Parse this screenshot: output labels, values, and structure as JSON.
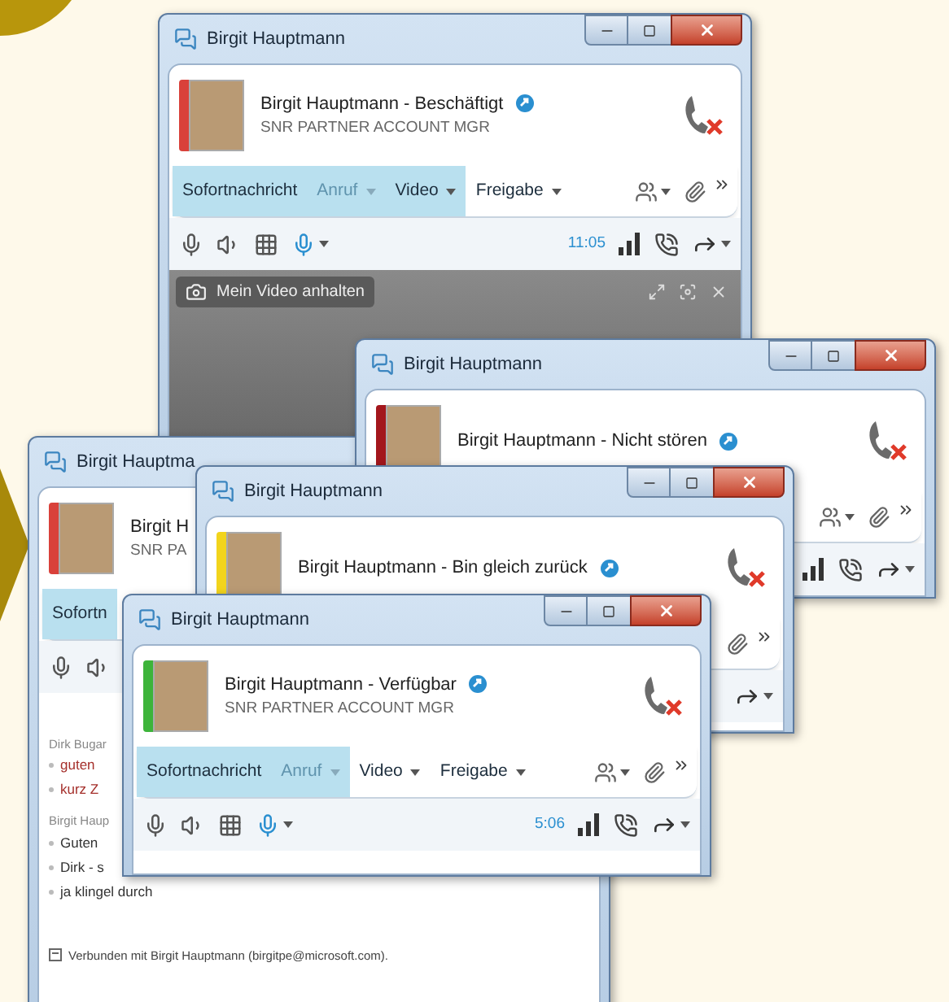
{
  "windows": [
    {
      "title": "Birgit Hauptmann",
      "color": "#d9413a",
      "name": "Birgit Hauptmann - Beschäftigt",
      "subtitle": "SNR PARTNER ACCOUNT MGR",
      "toolbar": [
        {
          "label": "Sofortnachricht",
          "disabled": false,
          "menu": false,
          "highlighted": true
        },
        {
          "label": "Anruf",
          "disabled": true,
          "menu": true,
          "highlighted": true
        },
        {
          "label": "Video",
          "disabled": false,
          "menu": true,
          "highlighted": true
        },
        {
          "label": "Freigabe",
          "disabled": false,
          "menu": true,
          "highlighted": false
        }
      ],
      "call_time": "11:05",
      "video_bar": {
        "label": "Mein Video anhalten"
      }
    },
    {
      "title": "Birgit Hauptma",
      "color": "#d9413a",
      "name": "Birgit H",
      "subtitle": "SNR PA",
      "toolbar": [
        {
          "label": "Sofortn",
          "disabled": false,
          "menu": false,
          "highlighted": true
        }
      ],
      "chat": {
        "groups": [
          {
            "sender": "Dirk Bugar",
            "kind": "remote",
            "messages": [
              "guten",
              "kurz Z"
            ]
          },
          {
            "sender": "Birgit Haup",
            "kind": "self",
            "messages": [
              "Guten",
              "Dirk - s",
              "ja klingel durch"
            ]
          }
        ],
        "status": "Verbunden mit Birgit Hauptmann (birgitpe@microsoft.com)."
      }
    },
    {
      "title": "Birgit Hauptmann",
      "color": "#a3161c",
      "name": "Birgit Hauptmann - Nicht stören"
    },
    {
      "title": "Birgit Hauptmann",
      "color": "#f2d41c",
      "name": "Birgit Hauptmann - Bin gleich zurück"
    },
    {
      "title": "Birgit Hauptmann",
      "color": "#3db43a",
      "name": "Birgit Hauptmann - Verfügbar",
      "subtitle": "SNR PARTNER ACCOUNT MGR",
      "toolbar": [
        {
          "label": "Sofortnachricht",
          "disabled": false,
          "menu": false,
          "highlighted": true
        },
        {
          "label": "Anruf",
          "disabled": true,
          "menu": true,
          "highlighted": true
        },
        {
          "label": "Video",
          "disabled": false,
          "menu": true,
          "highlighted": false
        },
        {
          "label": "Freigabe",
          "disabled": false,
          "menu": true,
          "highlighted": false
        }
      ],
      "call_time": "5:06"
    }
  ]
}
